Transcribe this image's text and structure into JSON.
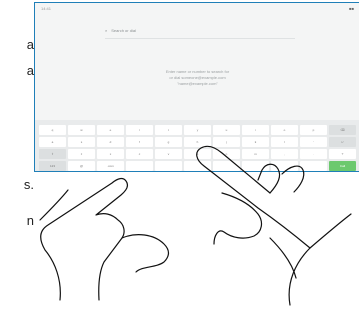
{
  "side_text": {
    "line1_tail": "a",
    "line2_tail": "a",
    "line3_tail": "s.",
    "line4_tail": "n"
  },
  "screen": {
    "top_label": "14:41",
    "top_meta": "■■",
    "search_icon": "search-icon",
    "search_placeholder": "Search or dial",
    "message_line1": "Enter name or number to search for",
    "message_line2": "or dial someone@example.com",
    "message_line3": "\"name@example.com\""
  },
  "keyboard": {
    "row1": [
      "q",
      "w",
      "e",
      "r",
      "t",
      "y",
      "u",
      "i",
      "o",
      "p",
      "⌫"
    ],
    "row2": [
      "a",
      "s",
      "d",
      "f",
      "g",
      "h",
      "j",
      "k",
      "l",
      "'",
      "↵"
    ],
    "row3": [
      "⇧",
      "z",
      "x",
      "c",
      "v",
      "b",
      "n",
      "m",
      ",",
      ".",
      "?"
    ],
    "row4": [
      "123",
      "@",
      ".com",
      "",
      "",
      "",
      "",
      "",
      "",
      "",
      "Call"
    ]
  },
  "colors": {
    "frame_border": "#1f7fb8",
    "call_key": "#6cc96e"
  }
}
